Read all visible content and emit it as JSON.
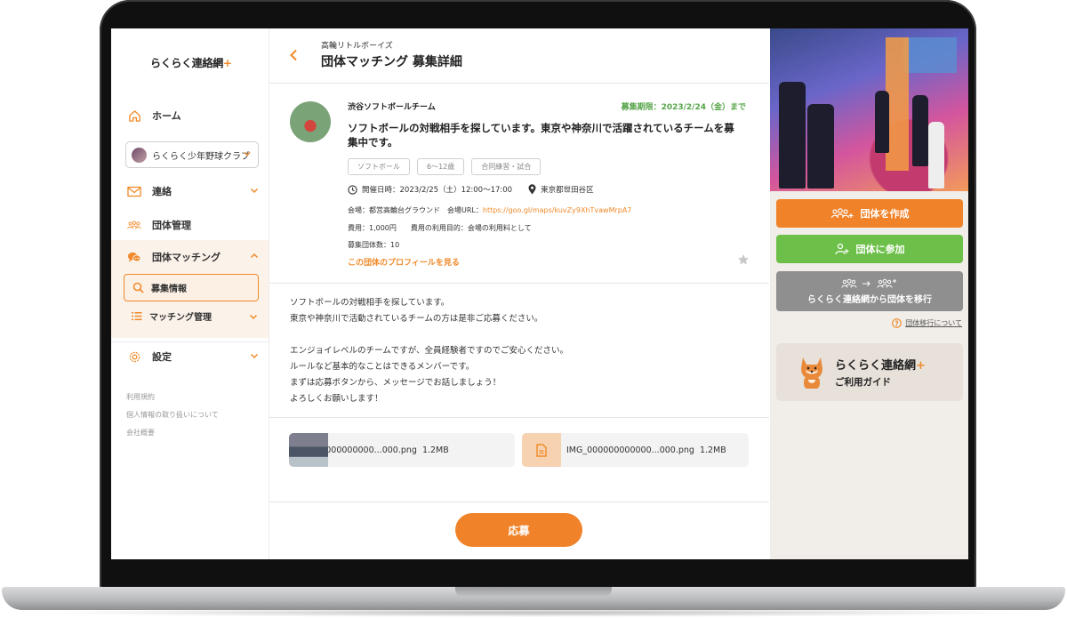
{
  "sidebar": {
    "logo": "らくらく連絡網",
    "logo_plus": "+",
    "home": "ホーム",
    "club": "らくらく少年野球クラブ",
    "contact": "連絡",
    "group_manage": "団体管理",
    "group_matching": "団体マッチング",
    "recruit_info": "募集情報",
    "matching_manage": "マッチング管理",
    "settings": "設定",
    "footer": [
      "利用規約",
      "個人情報の取り扱いについて",
      "会社概要"
    ]
  },
  "header": {
    "subtitle": "高輪リトルボーイズ",
    "title": "団体マッチング 募集詳細"
  },
  "post": {
    "team_name": "渋谷ソフトボールチーム",
    "deadline": "募集期限：2023/2/24（金）まで",
    "title": "ソフトボールの対戦相手を探しています。東京や神奈川で活躍されているチームを募集中です。",
    "tags": [
      "ソフトボール",
      "6〜12歳",
      "合同練習・試合"
    ],
    "datetime": "開催日時：2023/2/25（土）12:00〜17:00",
    "location": "東京都世田谷区",
    "venue": "会場：都営高輪台グラウンド　会場URL：",
    "venue_url": "https://goo.gl/maps/kuvZy9XhTvawMrpA7",
    "fee": "費用：1,000円　　費用の利用目的：会場の利用料として",
    "count": "募集団体数：10",
    "profile_link": "この団体のプロフィールを見る"
  },
  "description": "ソフトボールの対戦相手を探しています。\n東京や神奈川で活動されているチームの方は是非ご応募ください。\n\nエンジョイレベルのチームですが、全員経験者ですのでご安心ください。\nルールなど基本的なことはできるメンバーです。\nまずは応募ボタンから、メッセージでお話しましょう！\nよろしくお願いします！",
  "attachments": [
    {
      "name": "IMG_000000000000...000.png",
      "size": "1.2MB"
    },
    {
      "name": "IMG_000000000000...000.png",
      "size": "1.2MB"
    }
  ],
  "apply_label": "応募",
  "right": {
    "create_group": "団体を作成",
    "join_group": "団体に参加",
    "migrate": "らくらく連絡網から団体を移行",
    "migrate_about": "団体移行について",
    "guide_title": "らくらく連絡網",
    "guide_plus": "+",
    "guide_sub": "ご利用ガイド"
  },
  "colors": {
    "accent": "#f0832a",
    "green": "#6cbf48",
    "gray_button": "#8f8f8f",
    "deadline": "#57a54a"
  }
}
